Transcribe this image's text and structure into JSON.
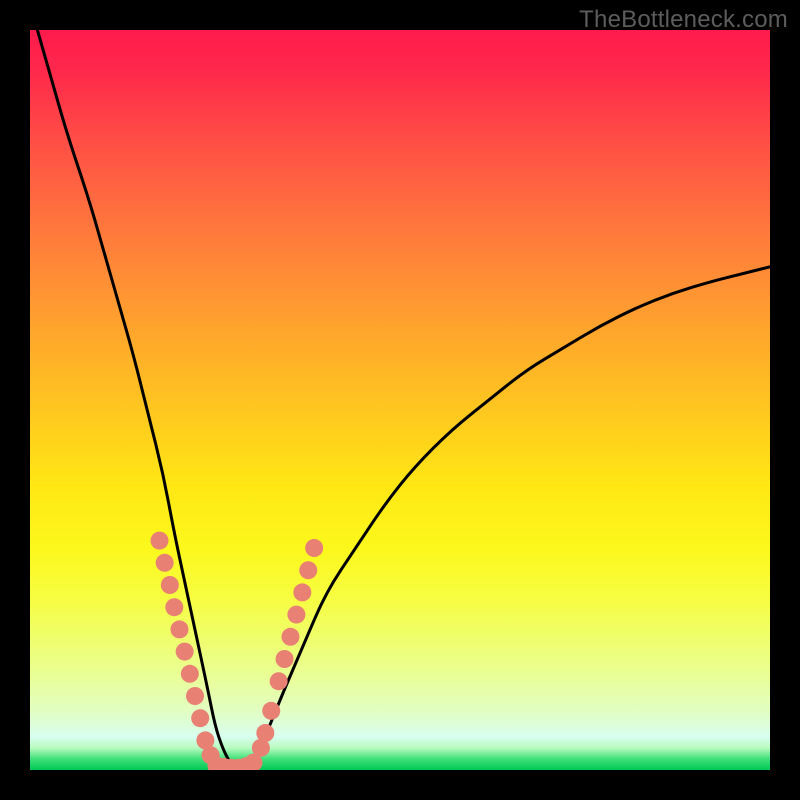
{
  "watermark": "TheBottleneck.com",
  "chart_data": {
    "type": "line",
    "title": "",
    "xlabel": "",
    "ylabel": "",
    "xlim": [
      0,
      100
    ],
    "ylim": [
      0,
      100
    ],
    "legend": false,
    "grid": false,
    "series": [
      {
        "name": "bottleneck-curve",
        "color": "#000000",
        "x": [
          1,
          3,
          5,
          8,
          10,
          12,
          14,
          16,
          18,
          19.5,
          21,
          22.5,
          24,
          25,
          26,
          27,
          28,
          29,
          30,
          32,
          34,
          37,
          40,
          44,
          48,
          52,
          57,
          62,
          67,
          72,
          77,
          82,
          87,
          92,
          96,
          100
        ],
        "y": [
          100,
          93,
          86,
          77,
          70,
          63,
          56,
          48,
          40,
          32,
          25,
          18,
          11,
          6,
          3,
          1,
          0,
          0,
          1,
          5,
          10,
          17,
          24,
          30,
          36,
          41,
          46,
          50,
          54,
          57,
          60,
          62.5,
          64.5,
          66,
          67,
          68
        ]
      },
      {
        "name": "markers-left-arm",
        "color": "#e88074",
        "marker": "circle",
        "x": [
          17.5,
          18.2,
          18.9,
          19.5,
          20.2,
          20.9,
          21.6,
          22.3,
          23.0,
          23.7,
          24.4
        ],
        "y": [
          31,
          28,
          25,
          22,
          19,
          16,
          13,
          10,
          7,
          4,
          2
        ]
      },
      {
        "name": "markers-bottom",
        "color": "#e88074",
        "marker": "circle",
        "x": [
          25.2,
          26.2,
          27.2,
          28.2,
          29.2,
          30.2
        ],
        "y": [
          0.6,
          0.4,
          0.3,
          0.3,
          0.5,
          1.0
        ]
      },
      {
        "name": "markers-right-arm",
        "color": "#e88074",
        "marker": "circle",
        "x": [
          31.2,
          31.8,
          32.6,
          33.6,
          34.4,
          35.2,
          36.0,
          36.8,
          37.6,
          38.4
        ],
        "y": [
          3,
          5,
          8,
          12,
          15,
          18,
          21,
          24,
          27,
          30
        ]
      }
    ],
    "gradient_background": {
      "direction": "vertical",
      "stops": [
        {
          "pos": 0.0,
          "color": "#ff1a4d"
        },
        {
          "pos": 0.24,
          "color": "#ff6e3f"
        },
        {
          "pos": 0.54,
          "color": "#ffcf1c"
        },
        {
          "pos": 0.77,
          "color": "#f6fd42"
        },
        {
          "pos": 0.92,
          "color": "#e2fec2"
        },
        {
          "pos": 1.0,
          "color": "#00c853"
        }
      ]
    }
  }
}
